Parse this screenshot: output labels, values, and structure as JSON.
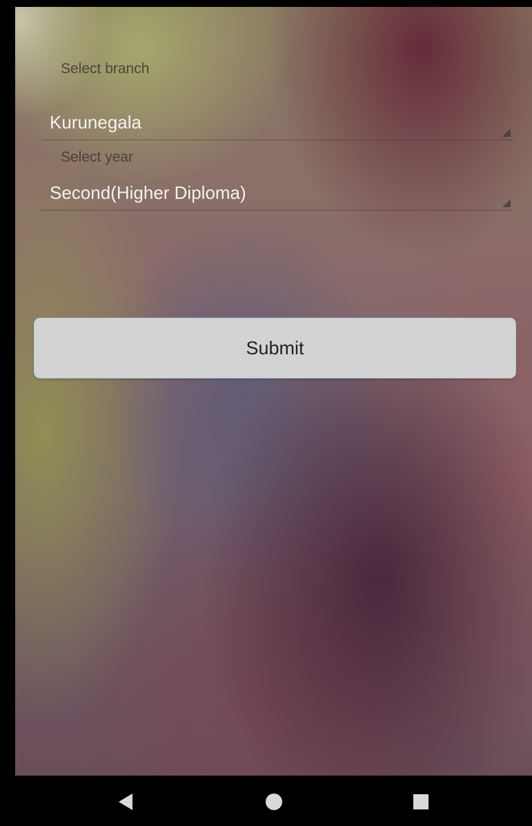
{
  "form": {
    "branch_label": "Select branch",
    "branch_value": "Kurunegala",
    "year_label": "Select year",
    "year_value": "Second(Higher Diploma)",
    "submit_label": "Submit"
  },
  "navbar": {
    "back_icon": "back-triangle-icon",
    "home_icon": "home-circle-icon",
    "recents_icon": "recents-square-icon"
  },
  "colors": {
    "button_bg": "#d3d3d3",
    "button_border": "#b4d7e6",
    "value_text": "#f4f2ef",
    "nav_icons": "#d9d9d9"
  }
}
